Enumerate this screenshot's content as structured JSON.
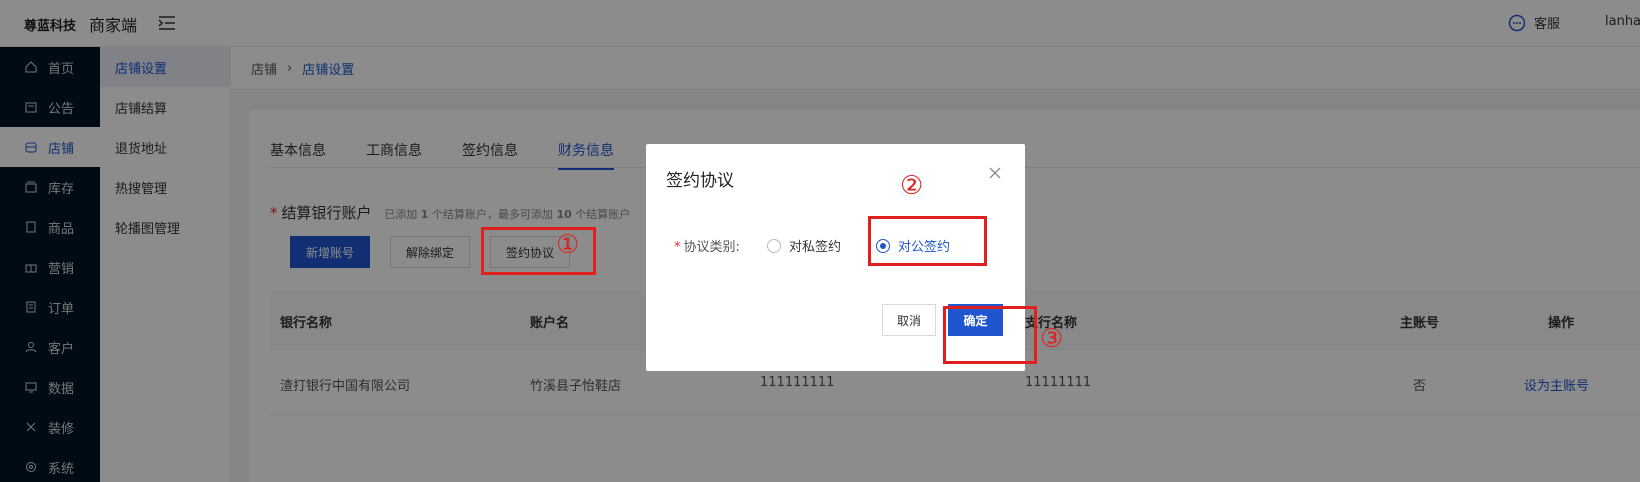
{
  "header": {
    "logo": "尊蓝科技",
    "app_name": "商家端",
    "service_label": "客服",
    "user_label": "lanha"
  },
  "sidebar": {
    "items": [
      {
        "label": "首页",
        "icon": "home-icon"
      },
      {
        "label": "公告",
        "icon": "notice-icon"
      },
      {
        "label": "店铺",
        "icon": "store-icon"
      },
      {
        "label": "库存",
        "icon": "inventory-icon"
      },
      {
        "label": "商品",
        "icon": "goods-icon"
      },
      {
        "label": "营销",
        "icon": "gift-icon"
      },
      {
        "label": "订单",
        "icon": "order-icon"
      },
      {
        "label": "客户",
        "icon": "user-icon"
      },
      {
        "label": "数据",
        "icon": "chart-icon"
      },
      {
        "label": "装修",
        "icon": "decor-icon"
      },
      {
        "label": "系统",
        "icon": "settings-icon"
      }
    ],
    "active": "店铺"
  },
  "submenu": {
    "items": [
      "店铺设置",
      "店铺结算",
      "退货地址",
      "热搜管理",
      "轮播图管理"
    ]
  },
  "breadcrumb": {
    "root": "店铺",
    "current": "店铺设置"
  },
  "tabs": [
    "基本信息",
    "工商信息",
    "签约信息",
    "财务信息"
  ],
  "section": {
    "title": "结算银行账户",
    "hint_prefix": "已添加",
    "count": "1",
    "hint_mid": "个结算账户，最多可添加",
    "max": "10",
    "hint_suffix": "个结算账户"
  },
  "buttons": {
    "add": "新增账号",
    "unbind": "解除绑定",
    "sign": "签约协议"
  },
  "table": {
    "headers": [
      "银行名称",
      "账户名",
      "支行名称",
      "主账号",
      "操作"
    ],
    "rows": [
      {
        "bank": "渣打银行中国有限公司",
        "account_name": "竹溪县子怡鞋店",
        "account_no": "111111111",
        "branch": "11111111",
        "main": "否",
        "action": "设为主账号"
      }
    ]
  },
  "modal": {
    "title": "签约协议",
    "field_label": "协议类别:",
    "option_private": "对私签约",
    "option_public": "对公签约",
    "selected": "对公签约",
    "cancel": "取消",
    "ok": "确定"
  },
  "annotations": {
    "mark1": "①",
    "mark2": "②",
    "mark3": "③"
  },
  "colors": {
    "primary": "#1f56cf",
    "sidebar_bg": "#001529",
    "annotation": "#e02020"
  }
}
